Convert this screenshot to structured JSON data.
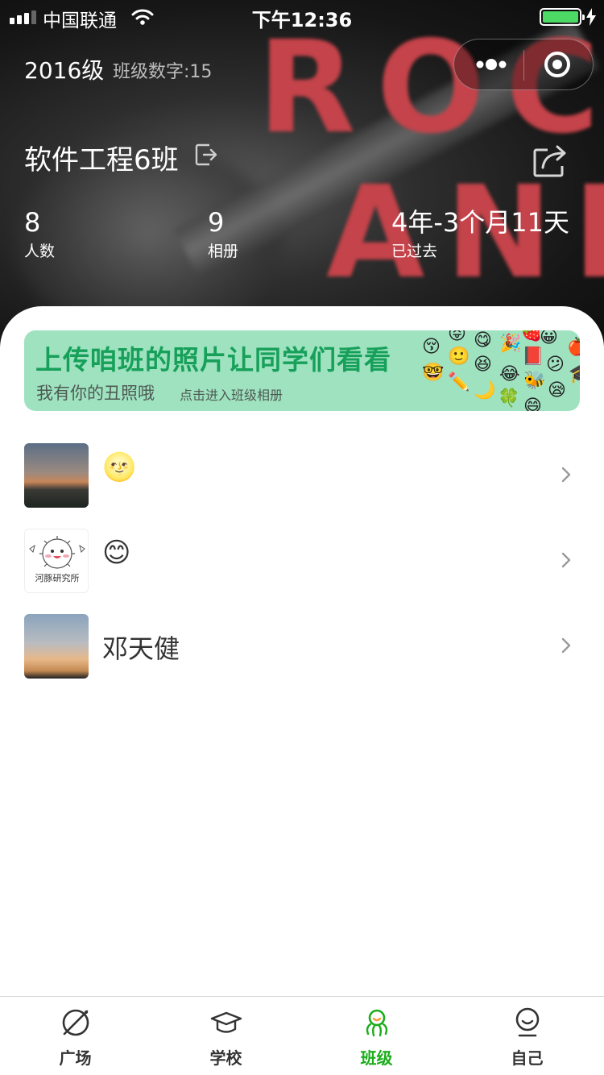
{
  "status_bar": {
    "carrier": "中国联通",
    "time": "下午12:36"
  },
  "header": {
    "grade": "2016级",
    "class_number_text": "班级数字:15",
    "class_name": "软件工程6班",
    "background_words": [
      "ROCK",
      "AND"
    ],
    "stats": [
      {
        "value": "8",
        "label": "人数"
      },
      {
        "value": "9",
        "label": "相册"
      },
      {
        "value": "4年-3个月11天",
        "label": "已过去"
      }
    ]
  },
  "banner": {
    "title": "上传咱班的照片让同学们看看",
    "subtitle": "我有你的丑照哦",
    "hint": "点击进入班级相册"
  },
  "members": [
    {
      "name": "🌝",
      "avatar": "dusk-road-photo"
    },
    {
      "name": "😊",
      "avatar": "pufferfish-lab-logo",
      "avatar_caption": "河豚研究所"
    },
    {
      "name": "邓天健",
      "avatar": "sunset-sky-photo"
    }
  ],
  "tab_bar": {
    "tabs": [
      {
        "label": "广场",
        "icon": "planet-icon",
        "active": false
      },
      {
        "label": "学校",
        "icon": "graduation-cap-icon",
        "active": false
      },
      {
        "label": "班级",
        "icon": "class-group-icon",
        "active": true
      },
      {
        "label": "自己",
        "icon": "person-smile-icon",
        "active": false
      }
    ]
  },
  "colors": {
    "accent": "#1aad19",
    "banner_bg": "#9fe2c0",
    "banner_title": "#17a05a",
    "battery": "#4cd964"
  }
}
